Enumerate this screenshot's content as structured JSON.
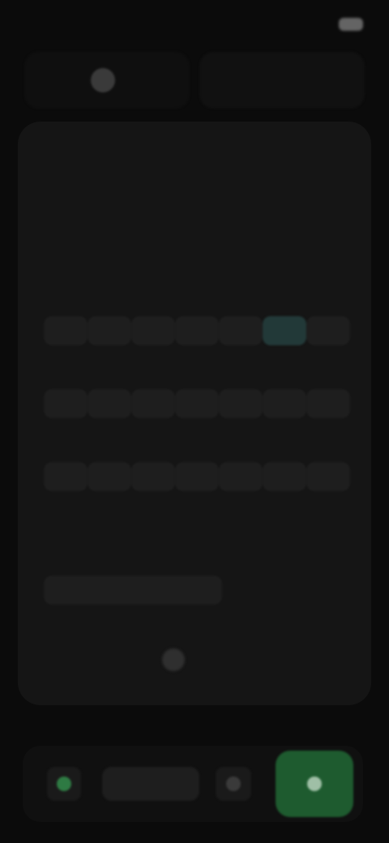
{
  "status_bar": {
    "time": "",
    "icons": "",
    "battery_icon": "battery-icon"
  },
  "top_toggle": {
    "left": {
      "label": "",
      "icon": "user-icon"
    },
    "right": {
      "label": ""
    }
  },
  "calendar": {
    "title": "",
    "weekdays": [
      "",
      "",
      "",
      "",
      ""
    ],
    "days": [
      "",
      "",
      "",
      "",
      "",
      "",
      "",
      "",
      "",
      "",
      "",
      "",
      "",
      "",
      "",
      "",
      "",
      "",
      "",
      "",
      ""
    ],
    "selected_day_index": 5,
    "time_text": ""
  },
  "bottom_bar": {
    "center_label": "",
    "primary_icon": "send-icon"
  },
  "colors": {
    "background": "#0b0b0b",
    "card": "#151515",
    "accent_green": "#1e5b2f",
    "selected_teal": "#3d7e7a"
  }
}
